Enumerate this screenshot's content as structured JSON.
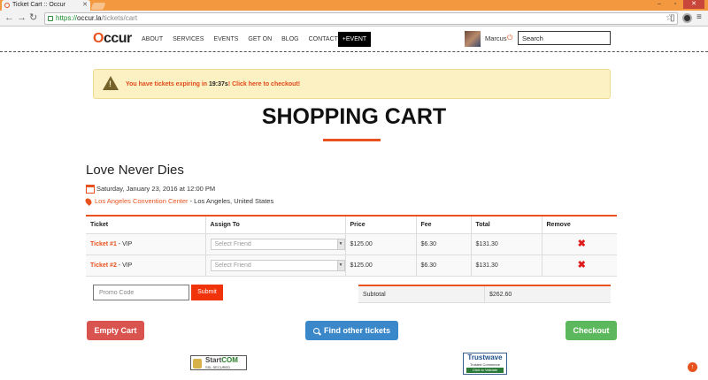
{
  "browser": {
    "tab_title": "Ticket Cart :: Occur",
    "url_scheme": "https://",
    "url_host": "occur.la",
    "url_path": "/tickets/cart"
  },
  "header": {
    "logo_o": "O",
    "logo_rest": "ccur",
    "nav": [
      "ABOUT",
      "SERVICES",
      "EVENTS",
      "GET ON",
      "BLOG",
      "CONTACT"
    ],
    "event_button": "+EVENT",
    "username": "Marcus",
    "search_placeholder": "Search"
  },
  "alert": {
    "prefix": "You have tickets expiring in ",
    "time": "19:37s",
    "suffix": "! Click here to checkout!"
  },
  "page_title": "SHOPPING CART",
  "event": {
    "name": "Love Never Dies",
    "date": "Saturday, January 23, 2016 at 12:00 PM",
    "venue": "Los Angeles Convention Center",
    "location": " - Los Angeles, United States"
  },
  "table": {
    "headers": [
      "Ticket",
      "Assign To",
      "Price",
      "Fee",
      "Total",
      "Remove"
    ],
    "rows": [
      {
        "ticket": "Ticket #1",
        "type": " - VIP",
        "assign": "Select Friend",
        "price": "$125.00",
        "fee": "$6.30",
        "total": "$131.30"
      },
      {
        "ticket": "Ticket #2",
        "type": " - VIP",
        "assign": "Select Friend",
        "price": "$125.00",
        "fee": "$6.30",
        "total": "$131.30"
      }
    ]
  },
  "promo": {
    "placeholder": "Promo Code",
    "submit": "Submit"
  },
  "subtotal": {
    "label": "Subtotal",
    "value": "$262.60"
  },
  "buttons": {
    "empty": "Empty Cart",
    "find": "Find other tickets",
    "checkout": "Checkout"
  },
  "badges": {
    "startcom_1": "Start",
    "startcom_2": "COM",
    "startcom_sub": "SSL SECURED",
    "trustwave_1": "Trustwave",
    "trustwave_2": "Trusted Commerce",
    "trustwave_3": "Click to Validate"
  },
  "colors": {
    "brand": "#e8521e",
    "danger": "#d9534f",
    "primary": "#3a87c9",
    "success": "#5cb85c"
  }
}
